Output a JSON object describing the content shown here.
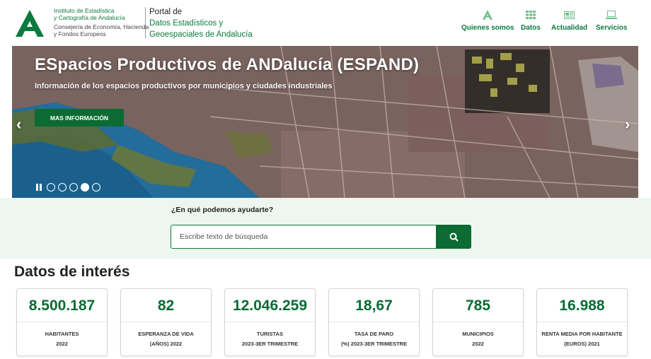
{
  "header": {
    "institute_line1": "Instituto de Estadística",
    "institute_line2": "y Cartografía de Andalucía",
    "consejeria_line1": "Consejería de Economía, Hacienda",
    "consejeria_line2": "y Fondos Europeos",
    "portal_line1": "Portal de",
    "portal_line2": "Datos Estadísticos y",
    "portal_line3": "Geoespaciales de Andalucía",
    "nav": [
      {
        "label": "Quienes somos",
        "icon": "andalucia-a-icon"
      },
      {
        "label": "Datos",
        "icon": "grid-icon"
      },
      {
        "label": "Actualidad",
        "icon": "newspaper-icon"
      },
      {
        "label": "Servicios",
        "icon": "laptop-icon"
      }
    ]
  },
  "hero": {
    "title": "ESpacios Productivos de ANDalucía (ESPAND)",
    "subtitle": "Información de los espacios productivos por municipios y ciudades industriales",
    "button": "MAS INFORMACIÓN",
    "prev": "‹",
    "next": "›",
    "slides_total": 5,
    "slide_active": 4
  },
  "search": {
    "question": "¿En qué podemos ayudarte?",
    "placeholder": "Escribe texto de búsqueda"
  },
  "stats": {
    "title": "Datos de interés",
    "cards": [
      {
        "value": "8.500.187",
        "label1": "HABITANTES",
        "label2": "2022"
      },
      {
        "value": "82",
        "label1": "ESPERANZA DE VIDA",
        "label2": "(AÑOS) 2022"
      },
      {
        "value": "12.046.259",
        "label1": "TURISTAS",
        "label2": "2023-3ER TRIMESTRE"
      },
      {
        "value": "18,67",
        "label1": "TASA DE PARO",
        "label2": "(%) 2023-3ER TRIMESTRE"
      },
      {
        "value": "785",
        "label1": "MUNICIPIOS",
        "label2": "2022"
      },
      {
        "value": "16.988",
        "label1": "RENTA MEDIA POR HABITANTE",
        "label2": "(EUROS) 2021"
      }
    ]
  },
  "colors": {
    "brand_green": "#0b7a3e",
    "button_green": "#0b6b33",
    "search_band": "#eef6f0"
  }
}
